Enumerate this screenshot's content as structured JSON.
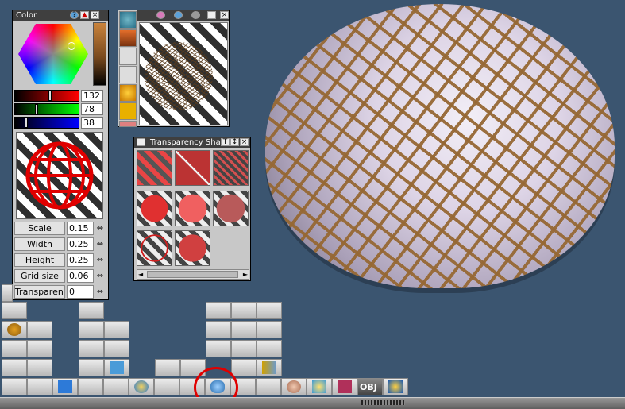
{
  "color_panel": {
    "title": "Color",
    "controls": [
      "?",
      "▲",
      "×"
    ],
    "rgb": [
      {
        "name": "red",
        "value": "132",
        "level": 0.52
      },
      {
        "name": "green",
        "value": "78",
        "level": 0.31
      },
      {
        "name": "blue",
        "value": "38",
        "level": 0.15
      }
    ]
  },
  "params": [
    {
      "label": "Scale",
      "value": "0.15",
      "name": "scale"
    },
    {
      "label": "Width",
      "value": "0.25",
      "name": "width"
    },
    {
      "label": "Height",
      "value": "0.25",
      "name": "height"
    },
    {
      "label": "Grid size",
      "value": "0.06",
      "name": "grid-size"
    },
    {
      "label": "Transparency",
      "value": "0",
      "name": "transparency"
    }
  ],
  "preview_panel": {
    "close": "×"
  },
  "shaders_panel": {
    "title": "Transparency Shaders",
    "controls": [
      "T",
      "↕",
      "×"
    ],
    "scroll_left": "◄",
    "scroll_right": "►"
  },
  "toolbar": {
    "obj_label": "OBJ"
  },
  "colors": {
    "background": "#3b5570",
    "panel": "#c8c8c8",
    "titlebar": "#3f3f3f",
    "highlight": "#e00000"
  }
}
